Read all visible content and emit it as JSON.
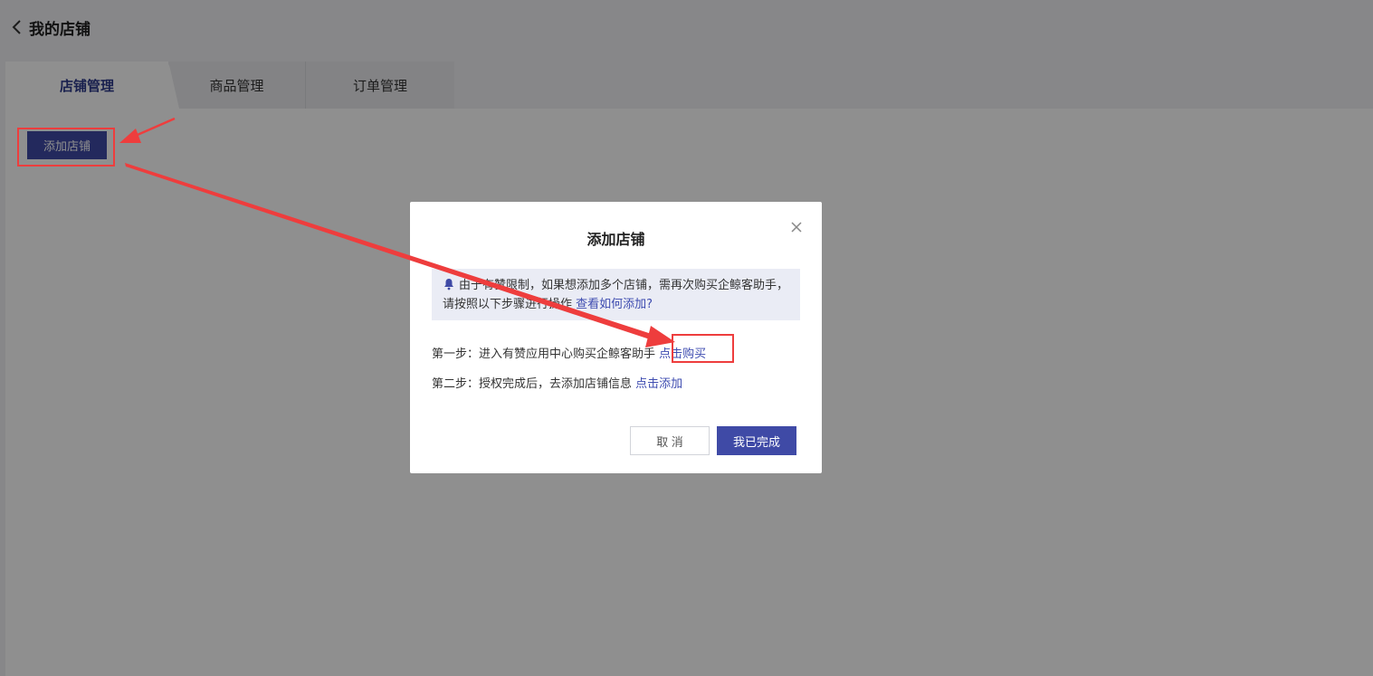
{
  "header": {
    "title": "我的店铺",
    "back_icon": "chevron-left-icon"
  },
  "tabs": [
    {
      "label": "店铺管理",
      "active": true
    },
    {
      "label": "商品管理",
      "active": false
    },
    {
      "label": "订单管理",
      "active": false
    }
  ],
  "toolbar": {
    "add_store_label": "添加店铺"
  },
  "modal": {
    "title": "添加店铺",
    "close_icon": "close-icon",
    "notice": {
      "icon": "bell-icon",
      "text": "由于有赞限制，如果想添加多个店铺，需再次购买企鲸客助手，请按照以下步骤进行操作",
      "link": "查看如何添加?"
    },
    "step1": {
      "text": "第一步：进入有赞应用中心购买企鲸客助手",
      "link": "点击购买"
    },
    "step2": {
      "text": "第二步：授权完成后，去添加店铺信息",
      "link": "点击添加"
    },
    "cancel_label": "取 消",
    "confirm_label": "我已完成"
  },
  "colors": {
    "primary": "#3f4aa6",
    "link": "#3e4cb0",
    "annotation": "#ee3d3d",
    "notice_bg": "#eaecf5"
  }
}
